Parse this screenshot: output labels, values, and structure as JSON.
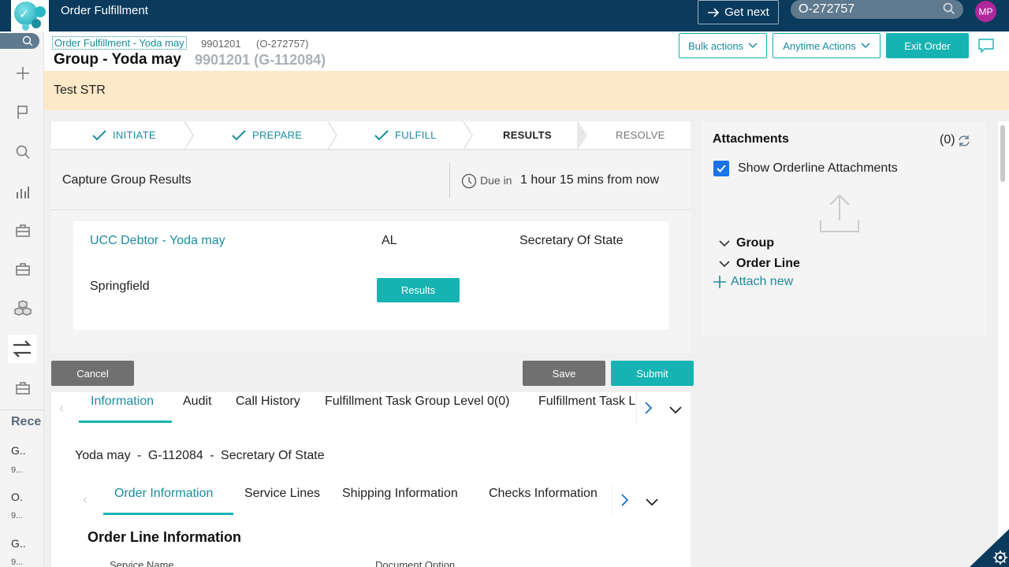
{
  "app": {
    "title": "Order Fulfillment"
  },
  "topbar": {
    "get_next": "Get next",
    "search_value": "O-272757",
    "avatar_initials": "MP"
  },
  "header": {
    "breadcrumb": "Order Fulfillment - Yoda may",
    "breadcrumb_id1": "9901201",
    "breadcrumb_id2": "(O-272757)",
    "title": "Group - Yoda may",
    "subtitle": "9901201 (G-112084)",
    "bulk_actions": "Bulk actions",
    "anytime_actions": "Anytime Actions",
    "exit_order": "Exit Order"
  },
  "banner": {
    "text": "Test STR"
  },
  "stepper": {
    "steps": [
      {
        "label": "INITIATE",
        "state": "done"
      },
      {
        "label": "PREPARE",
        "state": "done"
      },
      {
        "label": "FULFILL",
        "state": "done"
      },
      {
        "label": "RESULTS",
        "state": "current"
      },
      {
        "label": "RESOLVE",
        "state": "future"
      }
    ]
  },
  "capture": {
    "title": "Capture Group Results",
    "due_label": "Due in",
    "due_value": "1 hour 15 mins from now"
  },
  "result_card": {
    "debtor_link": "UCC Debtor - Yoda may",
    "state": "AL",
    "agency": "Secretary Of State",
    "city": "Springfield",
    "results_button": "Results"
  },
  "actions": {
    "cancel": "Cancel",
    "save": "Save",
    "submit": "Submit"
  },
  "main_tabs": {
    "items": [
      "Information",
      "Audit",
      "Call History",
      "Fulfillment Task Group Level 0(0)",
      "Fulfillment Task L"
    ],
    "active": "Information"
  },
  "summary": {
    "name": "Yoda may",
    "group_id": "G-112084",
    "agency": "Secretary Of State",
    "dash": "-"
  },
  "sub_tabs": {
    "items": [
      "Order Information",
      "Service Lines",
      "Shipping Information",
      "Checks Information"
    ],
    "active": "Order Information"
  },
  "order_line": {
    "title": "Order Line Information",
    "col_service_name": "Service Name",
    "col_document_option": "Document Option"
  },
  "attachments": {
    "title": "Attachments",
    "count": "(0)",
    "show_orderline": "Show Orderline Attachments",
    "tree_group": "Group",
    "tree_order_line": "Order Line",
    "attach_new": "Attach new"
  },
  "recent": {
    "label": "Rece",
    "items": [
      {
        "title": "G..",
        "sub": "9..."
      },
      {
        "title": "O.",
        "sub": "9..."
      },
      {
        "title": "G..",
        "sub": "9..."
      }
    ]
  },
  "colors": {
    "topbar": "#0a3a5c",
    "accent": "#17b3b3",
    "link": "#1a8c9e",
    "banner": "#fde8c8",
    "avatar": "#b0279b"
  }
}
